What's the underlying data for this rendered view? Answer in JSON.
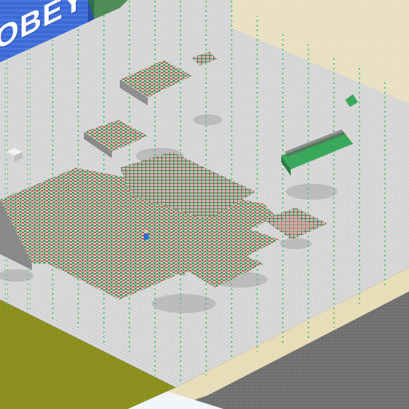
{
  "scene": {
    "banner": {
      "text": "OBEY",
      "color": "#3c6ad6"
    },
    "colors": {
      "floor": "#d9d9d9",
      "sand": "#ece4c8",
      "grass": "#8b8f1e",
      "asphalt": "#6e6e6e",
      "pillar": "#49c26c",
      "machine_green": "#3aa85a",
      "machine_red": "#c8503c",
      "shadow": "#9a9a9a"
    },
    "icons": [
      "banner-sign",
      "conveyor-stack",
      "player-avatar-icon",
      "crate-icon"
    ]
  }
}
